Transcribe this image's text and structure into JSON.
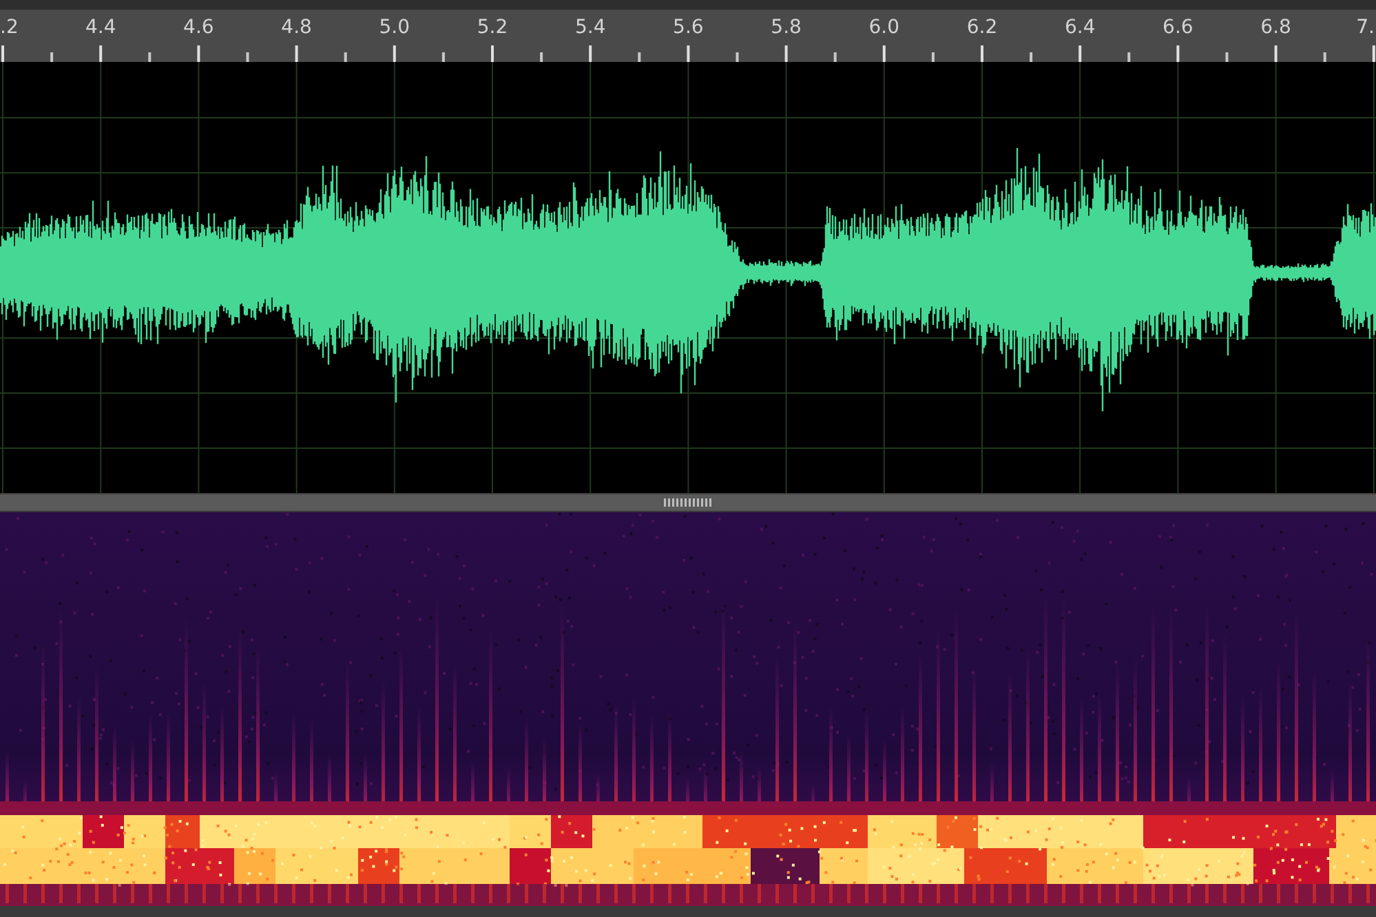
{
  "ruler": {
    "labels": [
      ".2",
      "4.4",
      "4.6",
      "4.8",
      "5.0",
      "5.2",
      "5.4",
      "5.6",
      "5.8",
      "6.0",
      "6.2",
      "6.4",
      "6.6",
      "6.8",
      "7."
    ]
  }
}
